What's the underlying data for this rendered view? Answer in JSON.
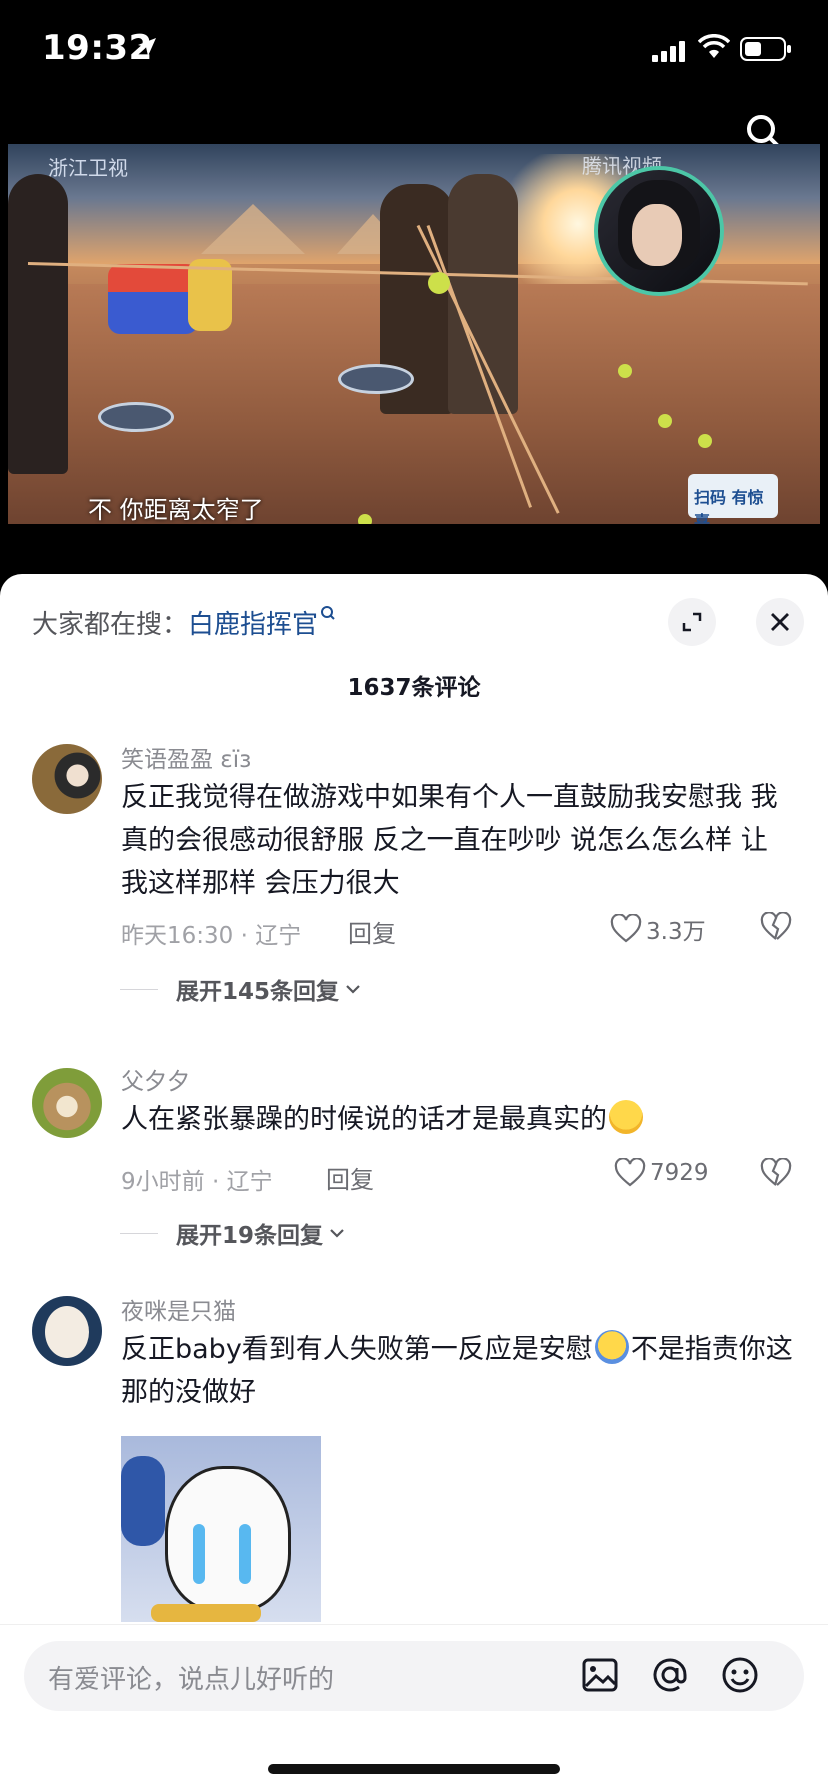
{
  "status": {
    "time": "19:32"
  },
  "video": {
    "channel_logo": "浙江卫视",
    "platform_logo": "腾讯视频",
    "subtitle": "不 你距离太窄了",
    "qr_text": "扫码 有惊喜"
  },
  "panel": {
    "hot_search_prefix": "大家都在搜：",
    "hot_search_keyword": "白鹿指挥官",
    "comment_count": "1637条评论"
  },
  "comments": [
    {
      "user": "笑语盈盈 ɛïз",
      "text": "反正我觉得在做游戏中如果有个人一直鼓励我安慰我 我真的会很感动很舒服 反之一直在吵吵 说怎么怎么样 让我这样那样 会压力很大",
      "meta": "昨天16:30 · 辽宁",
      "reply": "回复",
      "likes": "3.3万",
      "expand": "展开145条回复"
    },
    {
      "user": "父夕夕",
      "text": "人在紧张暴躁的时候说的话才是最真实的",
      "meta": "9小时前 · 辽宁",
      "reply": "回复",
      "likes": "7929",
      "expand": "展开19条回复"
    },
    {
      "user": "夜咪是只猫",
      "text_a": "反正baby看到有人失败第一反应是安慰",
      "text_b": "不是指责你这那的没做好"
    }
  ],
  "input": {
    "placeholder": "有爱评论，说点儿好听的"
  },
  "colors": {
    "keyword": "#1d4e91",
    "accent_ring": "#4cc7a7"
  }
}
